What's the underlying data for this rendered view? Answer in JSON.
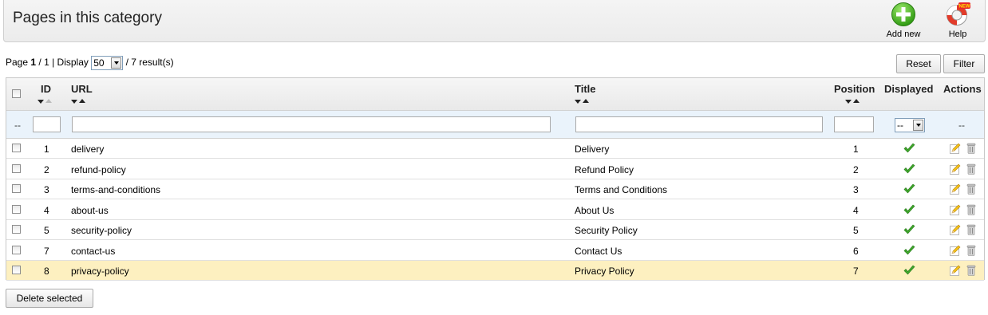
{
  "toolbar": {
    "title": "Pages in this category",
    "add_label": "Add new",
    "help_label": "Help",
    "help_badge": "NEW"
  },
  "pager": {
    "page_label": "Page",
    "current_page": "1",
    "total_pages": "/ 1",
    "display_label": "| Display",
    "per_page": "50",
    "results": "/ 7 result(s)"
  },
  "buttons": {
    "reset": "Reset",
    "filter": "Filter",
    "delete_selected": "Delete selected"
  },
  "table": {
    "headers": {
      "id": "ID",
      "url": "URL",
      "title": "Title",
      "position": "Position",
      "displayed": "Displayed",
      "actions": "Actions"
    },
    "filter": {
      "checkbox_placeholder": "--",
      "displayed_value": "--",
      "actions_placeholder": "--"
    },
    "rows": [
      {
        "id": "1",
        "url": "delivery",
        "title": "Delivery",
        "position": "1",
        "displayed": true
      },
      {
        "id": "2",
        "url": "refund-policy",
        "title": "Refund Policy",
        "position": "2",
        "displayed": true
      },
      {
        "id": "3",
        "url": "terms-and-conditions",
        "title": "Terms and Conditions",
        "position": "3",
        "displayed": true
      },
      {
        "id": "4",
        "url": "about-us",
        "title": "About Us",
        "position": "4",
        "displayed": true
      },
      {
        "id": "5",
        "url": "security-policy",
        "title": "Security Policy",
        "position": "5",
        "displayed": true
      },
      {
        "id": "7",
        "url": "contact-us",
        "title": "Contact Us",
        "position": "6",
        "displayed": true
      },
      {
        "id": "8",
        "url": "privacy-policy",
        "title": "Privacy Policy",
        "position": "7",
        "displayed": true
      }
    ]
  },
  "colors": {
    "highlight_row": "#fdf0c0",
    "filter_row": "#eaf3fb",
    "check_green": "#3fa82c",
    "add_green": "#3db51d"
  },
  "icons": {
    "add": "plus-circle-icon",
    "help": "lifebuoy-icon",
    "displayed": "checkmark-icon",
    "edit": "pencil-icon",
    "delete": "trash-icon"
  }
}
